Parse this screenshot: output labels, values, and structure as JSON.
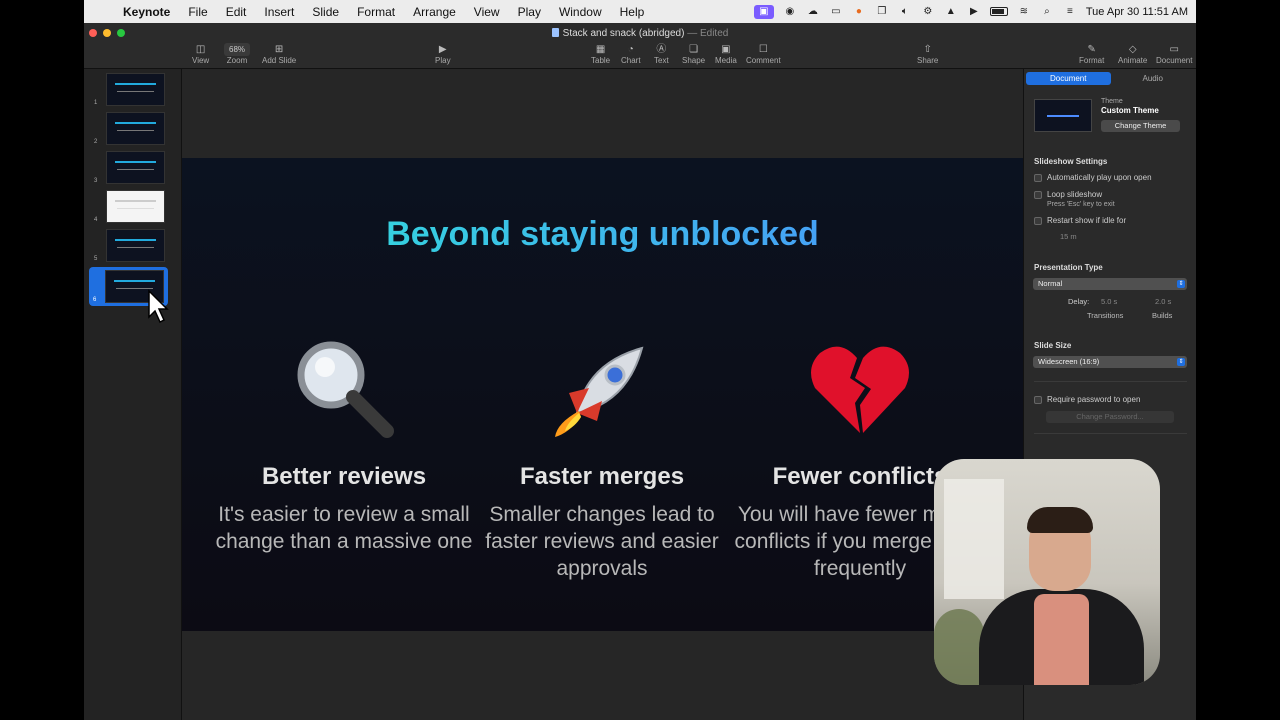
{
  "menubar": {
    "app_name": "Keynote",
    "menus": [
      "File",
      "Edit",
      "Insert",
      "Slide",
      "Format",
      "Arrange",
      "View",
      "Play",
      "Window",
      "Help"
    ],
    "clock": "Tue Apr 30  11:51 AM"
  },
  "window": {
    "title": "Stack and snack (abridged)",
    "status": "— Edited"
  },
  "toolbar": {
    "view": "View",
    "zoom_label": "Zoom",
    "zoom_value": "68%",
    "add_slide": "Add Slide",
    "play": "Play",
    "table": "Table",
    "chart": "Chart",
    "text": "Text",
    "shape": "Shape",
    "media": "Media",
    "comment": "Comment",
    "share": "Share",
    "format": "Format",
    "animate": "Animate",
    "document": "Document"
  },
  "navigator": {
    "slides": [
      {
        "num": "1",
        "style": "dark"
      },
      {
        "num": "2",
        "style": "dark"
      },
      {
        "num": "3",
        "style": "dark"
      },
      {
        "num": "4",
        "style": "white"
      },
      {
        "num": "5",
        "style": "dark"
      },
      {
        "num": "6",
        "style": "dark",
        "selected": true
      }
    ]
  },
  "slide": {
    "title": "Beyond staying unblocked",
    "columns": [
      {
        "emoji": "magnifying-glass",
        "heading": "Better reviews",
        "body": "It's easier to review a small change than a massive one"
      },
      {
        "emoji": "rocket",
        "heading": "Faster merges",
        "body": "Smaller changes lead to faster reviews and easier approvals"
      },
      {
        "emoji": "broken-heart",
        "heading": "Fewer conflicts",
        "body": "You will have fewer merge conflicts if you merge more frequently"
      }
    ]
  },
  "inspector": {
    "tabs": [
      "Document",
      "Audio"
    ],
    "theme_label": "Theme",
    "theme_name": "Custom Theme",
    "change_theme": "Change Theme",
    "slideshow_settings": "Slideshow Settings",
    "auto_play": "Automatically play upon open",
    "loop": "Loop slideshow",
    "loop_sub": "Press 'Esc' key to exit",
    "restart": "Restart show if idle for",
    "idle_value": "15 m",
    "presentation_type": "Presentation Type",
    "presentation_value": "Normal",
    "delay_label": "Delay:",
    "transitions_value": "5.0 s",
    "builds_value": "2.0 s",
    "transitions_label": "Transitions",
    "builds_label": "Builds",
    "slide_size": "Slide Size",
    "slide_size_value": "Widescreen (16:9)",
    "require_password": "Require password to open",
    "change_password": "Change Password..."
  },
  "colors": {
    "accent": "#1f6fe0",
    "title_gradient_start": "#2ee6d6",
    "title_gradient_end": "#4d8cff"
  }
}
